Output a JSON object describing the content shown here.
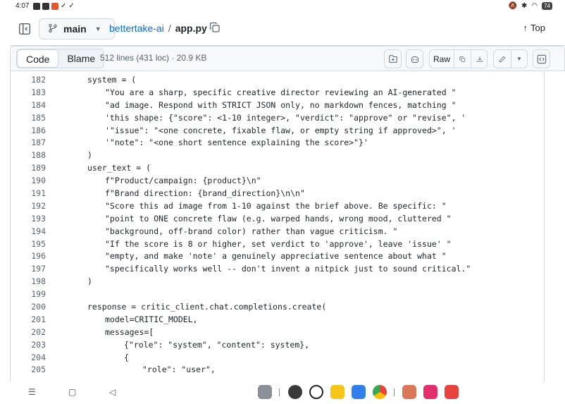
{
  "status_bar": {
    "time": "4:07",
    "battery": "74"
  },
  "header": {
    "branch": "main",
    "repo": "bettertake-ai",
    "separator": "/",
    "file": "app.py",
    "top_label": "Top"
  },
  "file_toolbar": {
    "tab_code": "Code",
    "tab_blame": "Blame",
    "meta": "512 lines (431 loc) · 20.9 KB",
    "raw_label": "Raw"
  },
  "code": {
    "lines": [
      {
        "n": "182",
        "indent": 1,
        "text": "system = ("
      },
      {
        "n": "183",
        "indent": 2,
        "text": "\"You are a sharp, specific creative director reviewing an AI-generated \""
      },
      {
        "n": "184",
        "indent": 2,
        "text": "\"ad image. Respond with STRICT JSON only, no markdown fences, matching \""
      },
      {
        "n": "185",
        "indent": 2,
        "text": "'this shape: {\"score\": <1-10 integer>, \"verdict\": \"approve\" or \"revise\", '"
      },
      {
        "n": "186",
        "indent": 2,
        "text": "'\"issue\": \"<one concrete, fixable flaw, or empty string if approved>\", '"
      },
      {
        "n": "187",
        "indent": 2,
        "text": "'\"note\": \"<one short sentence explaining the score>\"}'"
      },
      {
        "n": "188",
        "indent": 1,
        "text": ")"
      },
      {
        "n": "189",
        "indent": 1,
        "text": "user_text = ("
      },
      {
        "n": "190",
        "indent": 2,
        "text": "f\"Product/campaign: {product}\\n\""
      },
      {
        "n": "191",
        "indent": 2,
        "text": "f\"Brand direction: {brand_direction}\\n\\n\""
      },
      {
        "n": "192",
        "indent": 2,
        "text": "\"Score this ad image from 1-10 against the brief above. Be specific: \""
      },
      {
        "n": "193",
        "indent": 2,
        "text": "\"point to ONE concrete flaw (e.g. warped hands, wrong mood, cluttered \""
      },
      {
        "n": "194",
        "indent": 2,
        "text": "\"background, off-brand color) rather than vague criticism. \""
      },
      {
        "n": "195",
        "indent": 2,
        "text": "\"If the score is 8 or higher, set verdict to 'approve', leave 'issue' \""
      },
      {
        "n": "196",
        "indent": 2,
        "text": "\"empty, and make 'note' a genuinely appreciative sentence about what \""
      },
      {
        "n": "197",
        "indent": 2,
        "text": "\"specifically works well -- don't invent a nitpick just to sound critical.\""
      },
      {
        "n": "198",
        "indent": 1,
        "text": ")"
      },
      {
        "n": "199",
        "indent": 1,
        "text": ""
      },
      {
        "n": "200",
        "indent": 1,
        "text": "response = critic_client.chat.completions.create("
      },
      {
        "n": "201",
        "indent": 2,
        "text": "model=CRITIC_MODEL,"
      },
      {
        "n": "202",
        "indent": 2,
        "text": "messages=["
      },
      {
        "n": "203",
        "indent": 3,
        "text": "{\"role\": \"system\", \"content\": system},"
      },
      {
        "n": "204",
        "indent": 3,
        "text": "{"
      },
      {
        "n": "205",
        "indent": 4,
        "text": "\"role\": \"user\","
      }
    ]
  },
  "colors": {
    "link": "#0969da",
    "border": "#d1d9e0",
    "toolbar_bg": "#f6f8fa",
    "muted": "#59636e"
  },
  "nav_bar": {
    "icons": [
      "menu-icon",
      "home-icon",
      "back-icon"
    ],
    "dock_apps": [
      "app-drawer-icon",
      "camera-icon",
      "chatgpt-icon",
      "notes-icon",
      "files-icon",
      "chrome-icon",
      "claude-icon",
      "instagram-icon",
      "wps-icon"
    ]
  }
}
